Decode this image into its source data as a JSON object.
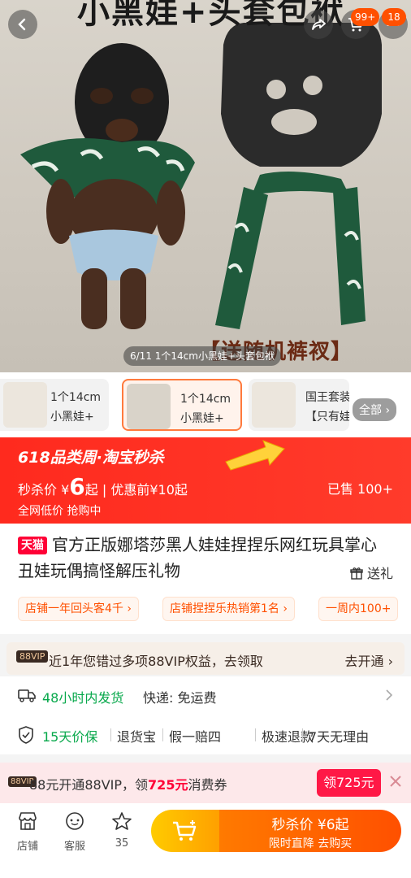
{
  "hero": {
    "title": "小黑娃+头套包袱",
    "caption": "【送随机裤衩】",
    "image_counter": "6/11 1个14cm小黑娃+头套包袱"
  },
  "top_bar": {
    "back_icon": "chevron-left-icon",
    "share_icon": "share-icon",
    "cart_icon": "cart-icon",
    "cart_badge": "99+",
    "more_badge": "18"
  },
  "thumbnails": {
    "items": [
      {
        "line1": "1个14cm",
        "line2": "小黑娃+"
      },
      {
        "line1": "1个14cm",
        "line2": "小黑娃+",
        "selected": true
      },
      {
        "line1": "国王套装",
        "line2": "【只有娃"
      }
    ],
    "all_label": "全部"
  },
  "promo": {
    "header": "618品类周·淘宝秒杀",
    "price_prefix": "秒杀价",
    "currency": "¥",
    "price": "6",
    "price_suffix": "起",
    "pre_discount": "优惠前¥10起",
    "sold": "已售 100+",
    "low_price": "全网低价 抢购中",
    "accent_color": "#ff2a1e"
  },
  "product": {
    "store_badge": "天猫",
    "title": "官方正版娜塔莎黑人娃娃捏捏乐网红玩具掌心丑娃玩偶搞怪解压礼物",
    "gift_label": "送礼",
    "chips": [
      "店铺一年回头客4千 ›",
      "店铺捏捏乐热销第1名 ›",
      "一周内100+"
    ]
  },
  "vip_benefit": {
    "tag": "88VIP",
    "text": "近1年您错过多项88VIP权益，去领取",
    "action": "去开通 ›"
  },
  "shipping": {
    "highlight": "48小时内发货",
    "delivery": "快递: 免运费"
  },
  "guarantee": {
    "highlight": "15天价保",
    "items": [
      "退货宝",
      "假一赔四",
      "极速退款",
      "7天无理由"
    ]
  },
  "vip_strip": {
    "tag": "88VIP",
    "text_prefix": "88元开通88VIP，领",
    "amount": "725元",
    "text_suffix": "消费券",
    "button": "领725元"
  },
  "bottom_bar": {
    "store": "店铺",
    "service": "客服",
    "favorites_count": "35",
    "buy_line1": "秒杀价 ¥6起",
    "buy_line2": "限时直降 去购买"
  }
}
